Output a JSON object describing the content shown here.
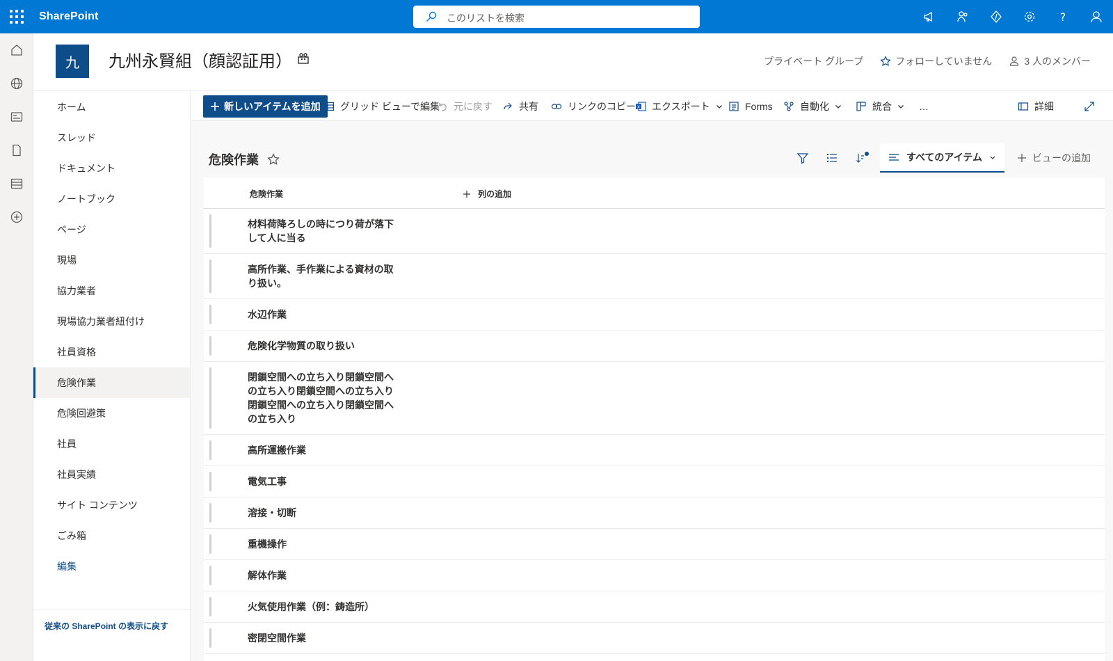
{
  "suite": {
    "brand": "SharePoint",
    "search_placeholder": "このリストを検索"
  },
  "site": {
    "logo_letter": "九",
    "title": "九州永賢組（顔認証用）",
    "privacy": "プライベート グループ",
    "follow": "フォローしていません",
    "members": "3 人のメンバー"
  },
  "nav": {
    "items": [
      {
        "label": "ホーム"
      },
      {
        "label": "スレッド"
      },
      {
        "label": "ドキュメント"
      },
      {
        "label": "ノートブック"
      },
      {
        "label": "ページ"
      },
      {
        "label": "現場"
      },
      {
        "label": "協力業者"
      },
      {
        "label": "現場協力業者紐付け"
      },
      {
        "label": "社員資格"
      },
      {
        "label": "危険作業",
        "selected": true
      },
      {
        "label": "危険回避策"
      },
      {
        "label": "社員"
      },
      {
        "label": "社員実績"
      },
      {
        "label": "サイト コンテンツ"
      },
      {
        "label": "ごみ箱"
      }
    ],
    "edit": "編集",
    "classic": "従来の SharePoint の表示に戻す"
  },
  "commands": {
    "new_item": "新しいアイテムを追加",
    "grid_edit": "グリッド ビューで編集",
    "undo": "元に戻す",
    "share": "共有",
    "copy_link": "リンクのコピー",
    "export": "エクスポート",
    "forms": "Forms",
    "automate": "自動化",
    "integrate": "統合",
    "more": "…",
    "details": "詳細"
  },
  "list": {
    "title": "危険作業",
    "view": "すべてのアイテム",
    "add_view": "ビューの追加",
    "column": "危険作業",
    "add_column": "列の追加",
    "rows": [
      "材料荷降ろしの時につり荷が落下して人に当る",
      "高所作業、手作業による資材の取り扱い。",
      "水辺作業",
      "危険化学物質の取り扱い",
      "閉鎖空間への立ち入り閉鎖空間への立ち入り閉鎖空間への立ち入り閉鎖空間への立ち入り閉鎖空間への立ち入り",
      "高所運搬作業",
      "電気工事",
      "溶接・切断",
      "重機操作",
      "解体作業",
      "火気使用作業（例：鋳造所）",
      "密閉空間作業"
    ]
  },
  "colors": {
    "suite_bar": "#0078d4",
    "brand": "#0f4c8a"
  }
}
